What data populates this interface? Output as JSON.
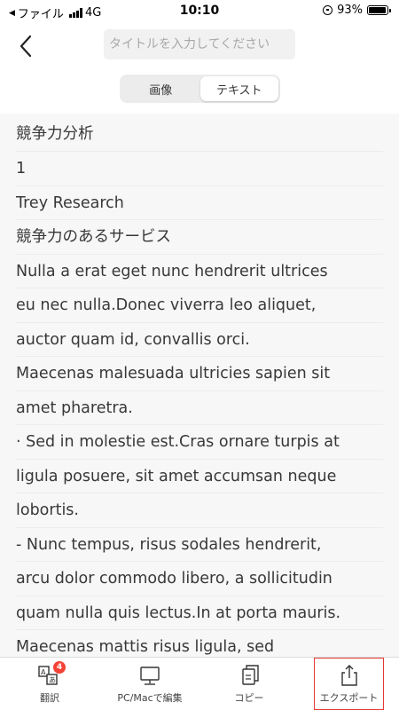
{
  "status_bar": {
    "carrier": "ファイル",
    "network": "4G",
    "time": "10:10",
    "battery": "93%",
    "battery_level": 0.93
  },
  "header": {
    "title_placeholder": "タイトルを入力してください"
  },
  "segmented": {
    "image_label": "画像",
    "text_label": "テキスト",
    "selected": "テキスト"
  },
  "content": {
    "lines": [
      "競争力分析",
      "1",
      "Trey Research",
      "競争力のあるサービス",
      "Nulla a erat eget nunc hendrerit ultrices",
      "eu nec nulla.Donec viverra leo aliquet,",
      "auctor quam id, convallis orci.",
      "Maecenas malesuada ultricies sapien sit",
      "amet pharetra.",
      "· Sed in molestie est.Cras ornare turpis at",
      "ligula posuere, sit amet accumsan neque",
      "lobortis.",
      "- Nunc tempus, risus sodales hendrerit,",
      "arcu dolor commodo libero, a sollicitudin",
      "quam nulla quis lectus.In at porta mauris.",
      "Maecenas mattis risus ligula, sed"
    ]
  },
  "tabbar": {
    "translate_label": "翻訳",
    "translate_badge": "4",
    "edit_label": "PC/Macで編集",
    "copy_label": "コピー",
    "export_label": "エクスポート"
  },
  "colors": {
    "accent_outline": "#e53935",
    "badge": "#f44336",
    "content_bg": "#f7f7f7"
  },
  "icons": [
    "back-chevron-icon",
    "signal-icon",
    "rotation-lock-icon",
    "battery-icon",
    "translate-icon",
    "monitor-icon",
    "copy-icon",
    "share-export-icon"
  ]
}
